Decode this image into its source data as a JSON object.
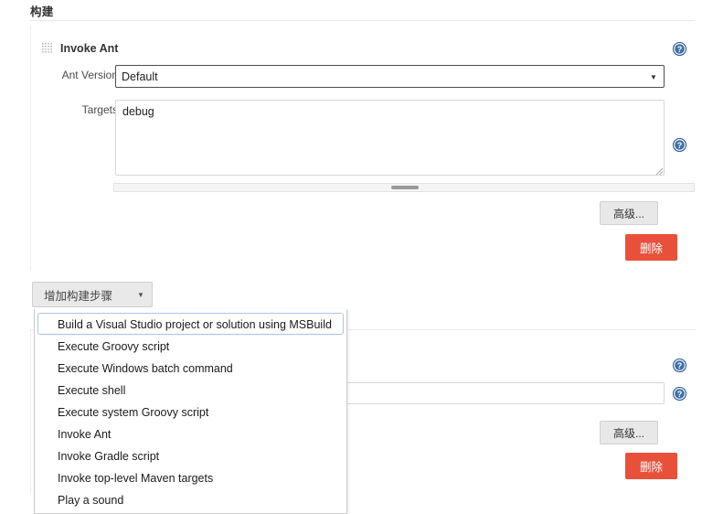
{
  "page": {
    "heading": "构建"
  },
  "colors": {
    "delete_button_bg": "#e8503a",
    "advanced_button_bg": "#e8e8e8",
    "addstep_button_bg": "#e9e9e9",
    "help_icon": "#2a5a96",
    "selected_item_border": "#a8c7ea"
  },
  "build_steps": [
    {
      "title": "Invoke Ant",
      "drag_handle_icon": "drag-grip-icon",
      "help_icon": "help-icon",
      "fields": [
        {
          "label": "Ant Version",
          "type": "select",
          "value": "Default",
          "options": [
            "Default"
          ]
        },
        {
          "label": "Targets",
          "type": "textarea",
          "value": "debug",
          "placeholder": ""
        }
      ],
      "advanced_label": "高级...",
      "delete_label": "删除"
    },
    {
      "title": "",
      "fields": [
        {
          "label": "",
          "type": "text",
          "value": "",
          "placeholder": ""
        }
      ],
      "advanced_label": "高级...",
      "delete_label": "删除"
    }
  ],
  "add_step": {
    "label": "增加构建步骤",
    "caret_icon": "chevron-down-icon",
    "menu_items": [
      {
        "label": "Build a Visual Studio project or solution using MSBuild",
        "selected": true
      },
      {
        "label": "Execute Groovy script",
        "selected": false
      },
      {
        "label": "Execute Windows batch command",
        "selected": false
      },
      {
        "label": "Execute shell",
        "selected": false
      },
      {
        "label": "Execute system Groovy script",
        "selected": false
      },
      {
        "label": "Invoke Ant",
        "selected": false
      },
      {
        "label": "Invoke Gradle script",
        "selected": false
      },
      {
        "label": "Invoke top-level Maven targets",
        "selected": false
      },
      {
        "label": "Play a sound",
        "selected": false
      }
    ]
  },
  "scrollbar": {
    "orientation": "horizontal",
    "thumb_position_percent": 50
  }
}
